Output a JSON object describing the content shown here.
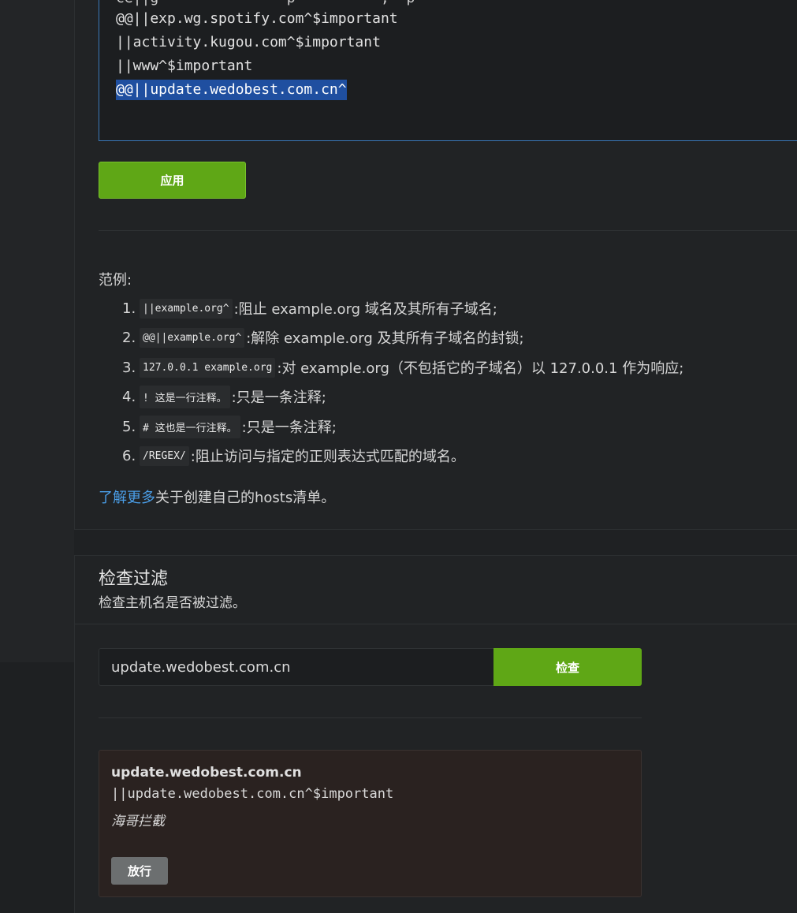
{
  "editor": {
    "lines": [
      "@@||exp.wg.spotify.com^$important",
      "||activity.kugou.com^$important",
      "||www^$important",
      "@@||update.wedobest.com.cn^"
    ],
    "partial_line": "ce||g               p          ,  p"
  },
  "apply_button": "应用",
  "examples": {
    "title": "范例:",
    "items": [
      {
        "num": "1.",
        "code": "||example.org^",
        "text": ":阻止 example.org 域名及其所有子域名;"
      },
      {
        "num": "2.",
        "code": "@@||example.org^",
        "text": ":解除 example.org 及其所有子域名的封锁;"
      },
      {
        "num": "3.",
        "code": "127.0.0.1 example.org",
        "text": ":对 example.org（不包括它的子域名）以 127.0.0.1 作为响应;"
      },
      {
        "num": "4.",
        "code": "! 这是一行注释。",
        "text": ":只是一条注释;"
      },
      {
        "num": "5.",
        "code": "# 这也是一行注释。",
        "text": ":只是一条注释;"
      },
      {
        "num": "6.",
        "code": "/REGEX/",
        "text": ":阻止访问与指定的正则表达式匹配的域名。"
      }
    ]
  },
  "learn_more": {
    "link": "了解更多",
    "text": "关于创建自己的hosts清单。"
  },
  "check_filter": {
    "title": "检查过滤",
    "subtitle": "检查主机名是否被过滤。",
    "input_value": "update.wedobest.com.cn",
    "button": "检查"
  },
  "result": {
    "host": "update.wedobest.com.cn",
    "rule": "||update.wedobest.com.cn^$important",
    "source": "海哥拦截",
    "allow_button": "放行"
  },
  "colors": {
    "accent_green": "#5fa716",
    "link_blue": "#4a9ee8",
    "selection_blue": "#1f4fa0"
  }
}
